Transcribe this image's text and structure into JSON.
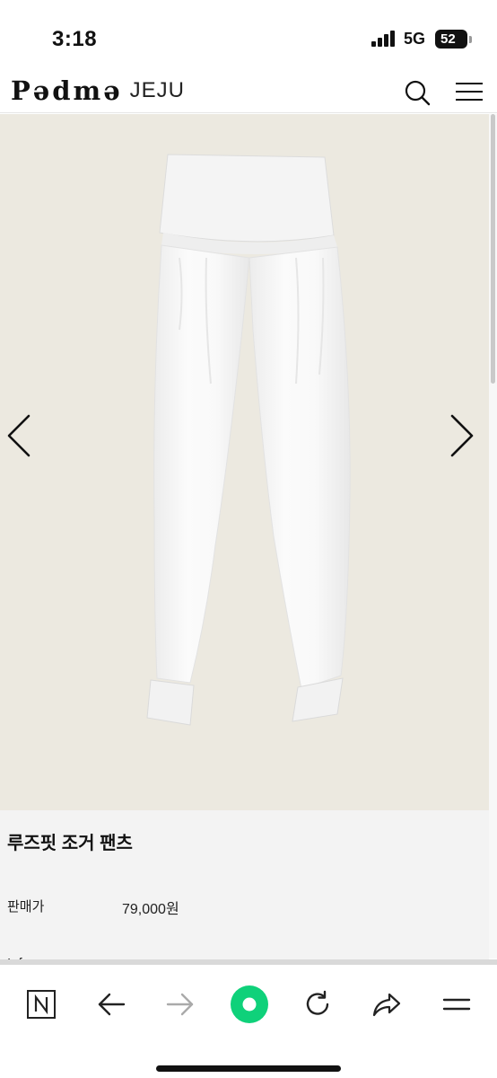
{
  "status_bar": {
    "time": "3:18",
    "network": "5G",
    "battery": "52"
  },
  "header": {
    "logo_mark": "Pədmə",
    "logo_sub": "JEJU",
    "search_icon": "search-icon",
    "menu_icon": "hamburger-menu-icon"
  },
  "gallery": {
    "prev_icon": "chevron-left-icon",
    "next_icon": "chevron-right-icon",
    "background_color": "#ece9e0"
  },
  "product": {
    "name": "루즈핏 조거 팬츠",
    "price_label": "판매가",
    "price_value": "79,000원",
    "info_label": "Info"
  },
  "toolbar": {
    "items": [
      "n-home-icon",
      "back-arrow-icon",
      "forward-arrow-icon",
      "green-dot-icon",
      "refresh-icon",
      "share-icon",
      "menu-icon"
    ],
    "accent_color": "#03c75a"
  }
}
